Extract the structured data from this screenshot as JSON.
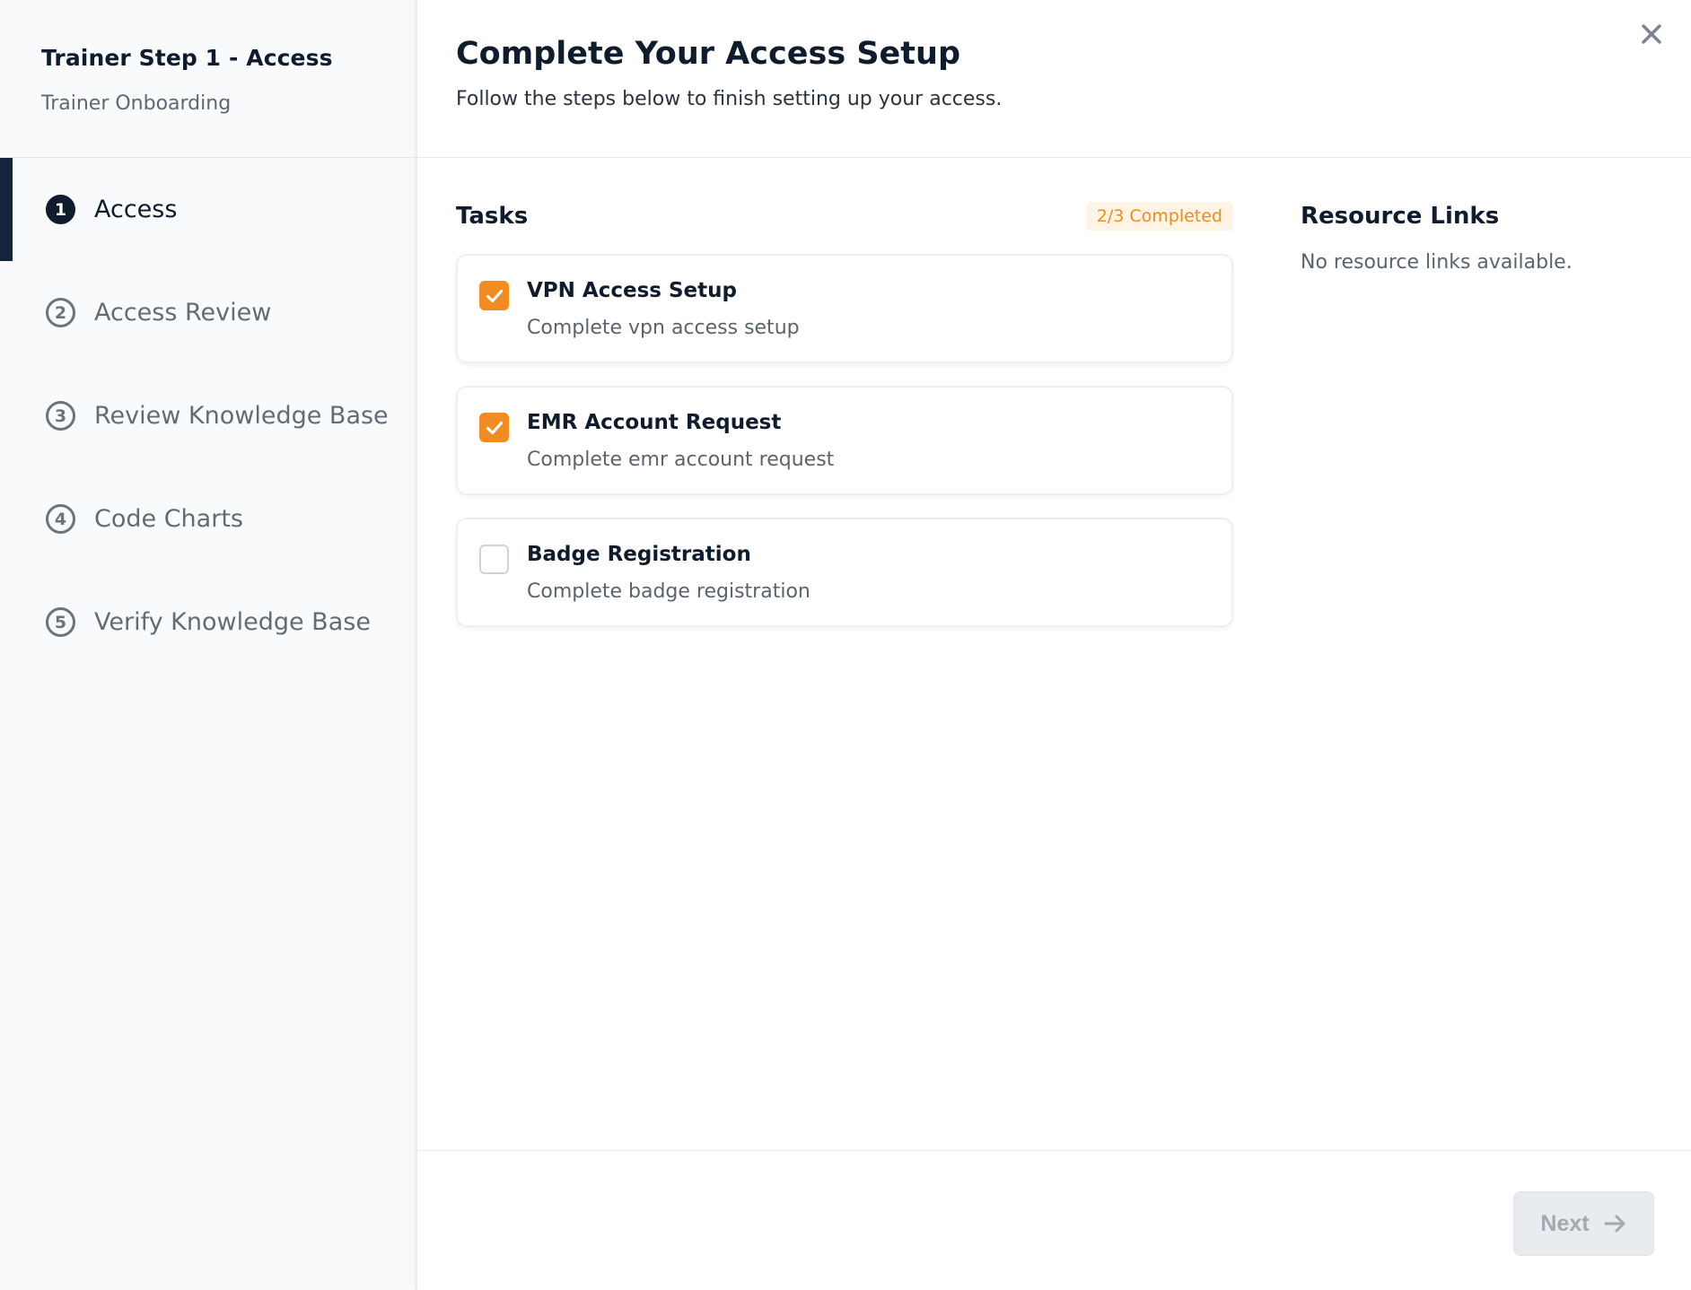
{
  "sidebar": {
    "title": "Trainer Step 1 - Access",
    "subtitle": "Trainer Onboarding",
    "steps": [
      {
        "number": "1",
        "label": "Access",
        "active": true
      },
      {
        "number": "2",
        "label": "Access Review",
        "active": false
      },
      {
        "number": "3",
        "label": "Review Knowledge Base",
        "active": false
      },
      {
        "number": "4",
        "label": "Code Charts",
        "active": false
      },
      {
        "number": "5",
        "label": "Verify Knowledge Base",
        "active": false
      }
    ]
  },
  "header": {
    "title": "Complete Your Access Setup",
    "subtitle": "Follow the steps below to finish setting up your access.",
    "close_icon": "close-icon"
  },
  "tasks": {
    "title": "Tasks",
    "progress": "2/3 Completed",
    "items": [
      {
        "title": "VPN Access Setup",
        "description": "Complete vpn access setup",
        "checked": true
      },
      {
        "title": "EMR Account Request",
        "description": "Complete emr account request",
        "checked": true
      },
      {
        "title": "Badge Registration",
        "description": "Complete badge registration",
        "checked": false
      }
    ]
  },
  "resources": {
    "title": "Resource Links",
    "empty_text": "No resource links available."
  },
  "footer": {
    "next_label": "Next",
    "next_icon": "arrow-right-icon",
    "next_disabled": true
  },
  "colors": {
    "accent": "#f28b22",
    "navy": "#0f1c2d",
    "badge_bg": "#fff4e6",
    "badge_text": "#f08a1c"
  }
}
